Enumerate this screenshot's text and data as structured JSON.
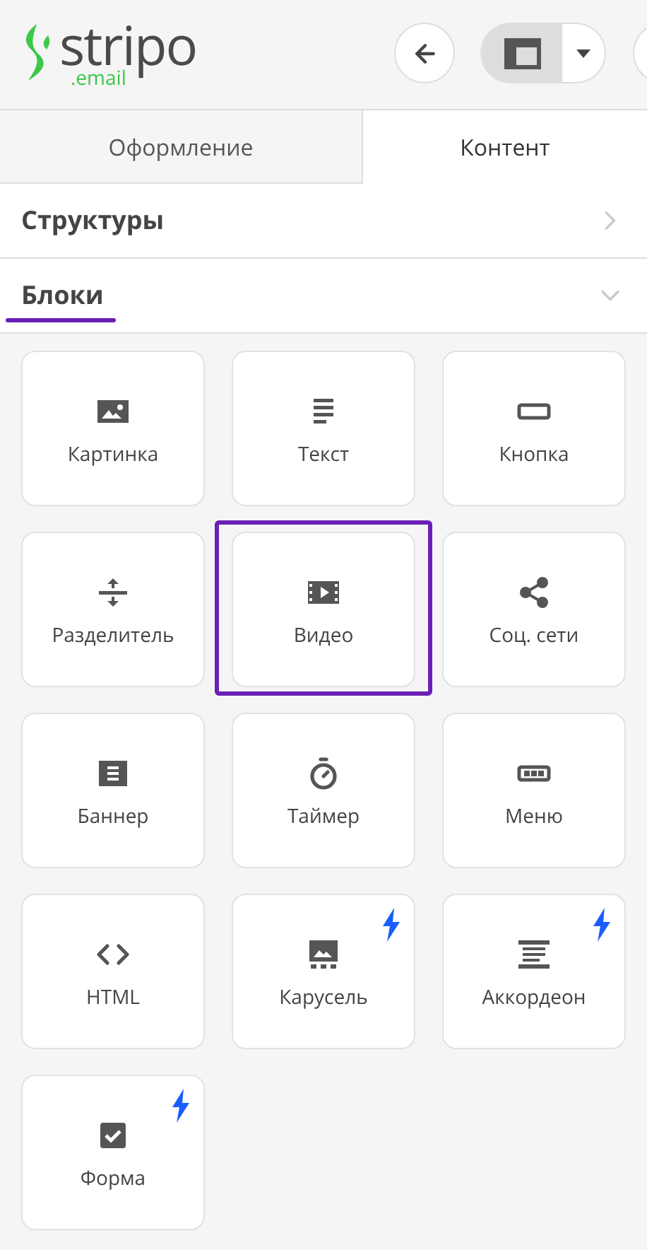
{
  "logo": {
    "name": "stripo",
    "domain": ".email"
  },
  "tabs": [
    {
      "label": "Оформление",
      "selected": false
    },
    {
      "label": "Контент",
      "selected": true
    }
  ],
  "sections": [
    {
      "title": "Структуры",
      "expanded": false
    },
    {
      "title": "Блоки",
      "expanded": true
    }
  ],
  "blocks": [
    {
      "kind": "image",
      "label": "Картинка",
      "selected": false,
      "amp": false
    },
    {
      "kind": "text",
      "label": "Текст",
      "selected": false,
      "amp": false
    },
    {
      "kind": "button",
      "label": "Кнопка",
      "selected": false,
      "amp": false
    },
    {
      "kind": "spacer",
      "label": "Разделитель",
      "selected": false,
      "amp": false
    },
    {
      "kind": "video",
      "label": "Видео",
      "selected": true,
      "amp": false
    },
    {
      "kind": "social",
      "label": "Соц. сети",
      "selected": false,
      "amp": false
    },
    {
      "kind": "banner",
      "label": "Баннер",
      "selected": false,
      "amp": false
    },
    {
      "kind": "timer",
      "label": "Таймер",
      "selected": false,
      "amp": false
    },
    {
      "kind": "menu",
      "label": "Меню",
      "selected": false,
      "amp": false
    },
    {
      "kind": "html",
      "label": "HTML",
      "selected": false,
      "amp": false
    },
    {
      "kind": "carousel",
      "label": "Карусель",
      "selected": false,
      "amp": true
    },
    {
      "kind": "accordion",
      "label": "Аккордеон",
      "selected": false,
      "amp": true
    },
    {
      "kind": "form",
      "label": "Форма",
      "selected": false,
      "amp": true
    }
  ]
}
